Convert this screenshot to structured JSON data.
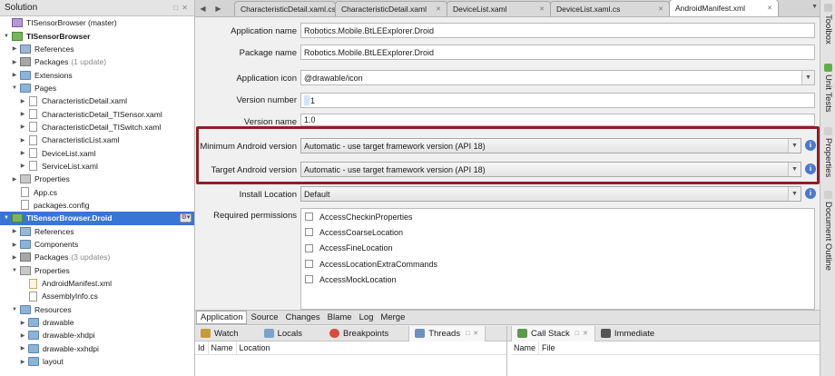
{
  "solution_pad": {
    "title": "Solution",
    "pad_buttons": "□ ✕",
    "tree": [
      {
        "label": "TISensorBrowser (master)",
        "note": "",
        "depth": 0,
        "icon": "solution",
        "expanded": true,
        "twisty": false,
        "bold": false,
        "selected": false
      },
      {
        "label": "TISensorBrowser",
        "note": "",
        "depth": 0,
        "icon": "project",
        "expanded": true,
        "twisty": true,
        "bold": true,
        "selected": false
      },
      {
        "label": "References",
        "note": "",
        "depth": 1,
        "icon": "refs",
        "expanded": false,
        "twisty": true,
        "bold": false,
        "selected": false
      },
      {
        "label": "Packages",
        "note": "(1 update)",
        "depth": 1,
        "icon": "pkgs",
        "expanded": false,
        "twisty": true,
        "bold": false,
        "selected": false
      },
      {
        "label": "Extensions",
        "note": "",
        "depth": 1,
        "icon": "folder",
        "expanded": false,
        "twisty": true,
        "bold": false,
        "selected": false
      },
      {
        "label": "Pages",
        "note": "",
        "depth": 1,
        "icon": "folder",
        "expanded": true,
        "twisty": true,
        "bold": false,
        "selected": false
      },
      {
        "label": "CharacteristicDetail.xaml",
        "note": "",
        "depth": 2,
        "icon": "file",
        "expanded": false,
        "twisty": true,
        "bold": false,
        "selected": false
      },
      {
        "label": "CharacteristicDetail_TISensor.xaml",
        "note": "",
        "depth": 2,
        "icon": "file",
        "expanded": false,
        "twisty": true,
        "bold": false,
        "selected": false
      },
      {
        "label": "CharacteristicDetail_TISwitch.xaml",
        "note": "",
        "depth": 2,
        "icon": "file",
        "expanded": false,
        "twisty": true,
        "bold": false,
        "selected": false
      },
      {
        "label": "CharacteristicList.xaml",
        "note": "",
        "depth": 2,
        "icon": "file",
        "expanded": false,
        "twisty": true,
        "bold": false,
        "selected": false
      },
      {
        "label": "DeviceList.xaml",
        "note": "",
        "depth": 2,
        "icon": "file",
        "expanded": false,
        "twisty": true,
        "bold": false,
        "selected": false
      },
      {
        "label": "ServiceList.xaml",
        "note": "",
        "depth": 2,
        "icon": "file",
        "expanded": false,
        "twisty": true,
        "bold": false,
        "selected": false
      },
      {
        "label": "Properties",
        "note": "",
        "depth": 1,
        "icon": "props",
        "expanded": false,
        "twisty": true,
        "bold": false,
        "selected": false
      },
      {
        "label": "App.cs",
        "note": "",
        "depth": 1,
        "icon": "file",
        "expanded": false,
        "twisty": false,
        "bold": false,
        "selected": false
      },
      {
        "label": "packages.config",
        "note": "",
        "depth": 1,
        "icon": "file",
        "expanded": false,
        "twisty": false,
        "bold": false,
        "selected": false
      },
      {
        "label": "TISensorBrowser.Droid",
        "note": "",
        "depth": 0,
        "icon": "project",
        "expanded": true,
        "twisty": true,
        "bold": true,
        "selected": true
      },
      {
        "label": "References",
        "note": "",
        "depth": 1,
        "icon": "refs",
        "expanded": false,
        "twisty": true,
        "bold": false,
        "selected": false
      },
      {
        "label": "Components",
        "note": "",
        "depth": 1,
        "icon": "folder",
        "expanded": false,
        "twisty": true,
        "bold": false,
        "selected": false
      },
      {
        "label": "Packages",
        "note": "(3 updates)",
        "depth": 1,
        "icon": "pkgs",
        "expanded": false,
        "twisty": true,
        "bold": false,
        "selected": false
      },
      {
        "label": "Properties",
        "note": "",
        "depth": 1,
        "icon": "props",
        "expanded": true,
        "twisty": true,
        "bold": false,
        "selected": false
      },
      {
        "label": "AndroidManifest.xml",
        "note": "",
        "depth": 2,
        "icon": "xml",
        "expanded": false,
        "twisty": false,
        "bold": false,
        "selected": false
      },
      {
        "label": "AssemblyInfo.cs",
        "note": "",
        "depth": 2,
        "icon": "file",
        "expanded": false,
        "twisty": false,
        "bold": false,
        "selected": false
      },
      {
        "label": "Resources",
        "note": "",
        "depth": 1,
        "icon": "folder",
        "expanded": true,
        "twisty": true,
        "bold": false,
        "selected": false
      },
      {
        "label": "drawable",
        "note": "",
        "depth": 2,
        "icon": "folder",
        "expanded": false,
        "twisty": true,
        "bold": false,
        "selected": false
      },
      {
        "label": "drawable-xhdpi",
        "note": "",
        "depth": 2,
        "icon": "folder",
        "expanded": false,
        "twisty": true,
        "bold": false,
        "selected": false
      },
      {
        "label": "drawable-xxhdpi",
        "note": "",
        "depth": 2,
        "icon": "folder",
        "expanded": false,
        "twisty": true,
        "bold": false,
        "selected": false
      },
      {
        "label": "layout",
        "note": "",
        "depth": 2,
        "icon": "folder",
        "expanded": false,
        "twisty": true,
        "bold": false,
        "selected": false
      }
    ]
  },
  "document_tabs": [
    {
      "label": "CharacteristicDetail.xaml.cs",
      "active": false
    },
    {
      "label": "CharacteristicDetail.xaml",
      "active": false
    },
    {
      "label": "DeviceList.xaml",
      "active": false
    },
    {
      "label": "DeviceList.xaml.cs",
      "active": false
    },
    {
      "label": "AndroidManifest.xml",
      "active": true
    }
  ],
  "manifest_form": {
    "application_name": {
      "label": "Application name",
      "value": "Robotics.Mobile.BtLEExplorer.Droid"
    },
    "package_name": {
      "label": "Package name",
      "value": "Robotics.Mobile.BtLEExplorer.Droid"
    },
    "application_icon": {
      "label": "Application icon",
      "value": "@drawable/icon"
    },
    "version_number": {
      "label": "Version number",
      "value": "1"
    },
    "version_name": {
      "label": "Version name",
      "value": "1.0"
    },
    "min_android_version": {
      "label": "Minimum Android version",
      "value": "Automatic - use target framework version (API 18)"
    },
    "target_android_version": {
      "label": "Target Android version",
      "value": "Automatic - use target framework version (API 18)"
    },
    "install_location": {
      "label": "Install Location",
      "value": "Default"
    },
    "required_permissions": {
      "label": "Required permissions",
      "items": [
        "AccessCheckinProperties",
        "AccessCoarseLocation",
        "AccessFineLocation",
        "AccessLocationExtraCommands",
        "AccessMockLocation"
      ]
    },
    "info_glyph": "i",
    "highlight_color": "#8e1f25"
  },
  "editor_tabs": [
    "Application",
    "Source",
    "Changes",
    "Blame",
    "Log",
    "Merge"
  ],
  "bottom_pads": {
    "left_tabs": [
      "Watch",
      "Locals",
      "Breakpoints",
      "Threads"
    ],
    "left_columns": [
      "Id",
      "Name",
      "Location"
    ],
    "right_tabs": [
      "Call Stack",
      "Immediate"
    ],
    "right_columns": [
      "Name",
      "File"
    ],
    "pad_buttons": "□ ✕"
  },
  "right_dock": [
    "Toolbox",
    "Unit Tests",
    "Properties",
    "Document Outline"
  ]
}
